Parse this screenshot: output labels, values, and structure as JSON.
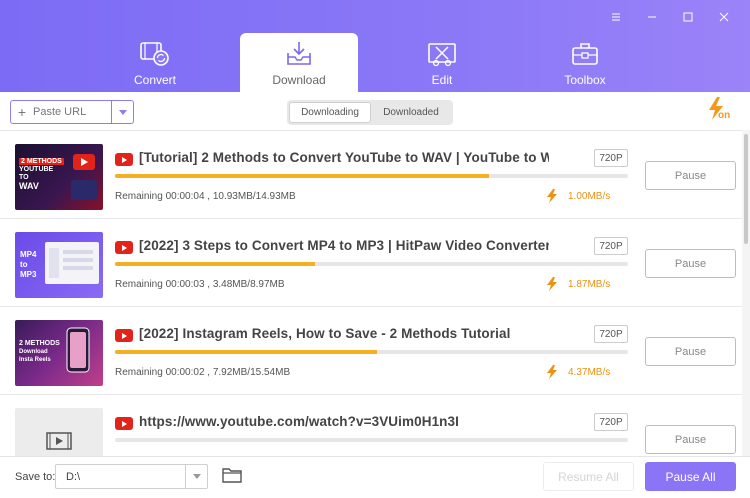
{
  "window": {
    "controls": [
      "menu-icon",
      "minimize-icon",
      "maximize-icon",
      "close-icon"
    ]
  },
  "tabs": [
    {
      "label": "Convert",
      "icon": "convert-icon",
      "active": false
    },
    {
      "label": "Download",
      "icon": "download-icon",
      "active": true
    },
    {
      "label": "Edit",
      "icon": "edit-icon",
      "active": false
    },
    {
      "label": "Toolbox",
      "icon": "toolbox-icon",
      "active": false
    }
  ],
  "toolbar": {
    "paste_url_label": "Paste URL",
    "segments": {
      "downloading": "Downloading",
      "downloaded": "Downloaded",
      "active": "downloading"
    },
    "turbo_label": "on"
  },
  "downloads": [
    {
      "title": "[Tutorial] 2 Methods to Convert YouTube to WAV | YouTube to W...",
      "quality": "720P",
      "progress": 0.73,
      "remaining": "Remaining 00:00:04 , 10.93MB/14.93MB",
      "speed": "1.00MB/s",
      "button": "Pause",
      "thumb_text": [
        "2 METHODS",
        "YOUTUBE",
        "TO",
        "WAV"
      ]
    },
    {
      "title": "[2022] 3 Steps to Convert MP4 to MP3 | HitPaw Video Converter T...",
      "quality": "720P",
      "progress": 0.39,
      "remaining": "Remaining 00:00:03 , 3.48MB/8.97MB",
      "speed": "1.87MB/s",
      "button": "Pause",
      "thumb_text": [
        "MP4",
        "to",
        "MP3"
      ]
    },
    {
      "title": "[2022] Instagram Reels, How to Save - 2 Methods Tutorial",
      "quality": "720P",
      "progress": 0.51,
      "remaining": "Remaining 00:00:02 , 7.92MB/15.54MB",
      "speed": "4.37MB/s",
      "button": "Pause",
      "thumb_text": [
        "2 METHODS",
        "Download",
        "Insta Reels"
      ]
    },
    {
      "title": "https://www.youtube.com/watch?v=3VUim0H1n3I",
      "quality": "720P",
      "progress": 0,
      "remaining": "",
      "speed": "",
      "button": "Pause",
      "thumb_text": []
    }
  ],
  "footer": {
    "save_to_label": "Save to:",
    "save_path": "D:\\",
    "resume_all_label": "Resume All",
    "pause_all_label": "Pause All"
  },
  "colors": {
    "header_gradient_start": "#7c6cf5",
    "header_gradient_end": "#9b83f8",
    "progress": "#f3b023",
    "speed": "#e89216",
    "accent": "#8b74f5",
    "youtube_red": "#e2231a"
  }
}
